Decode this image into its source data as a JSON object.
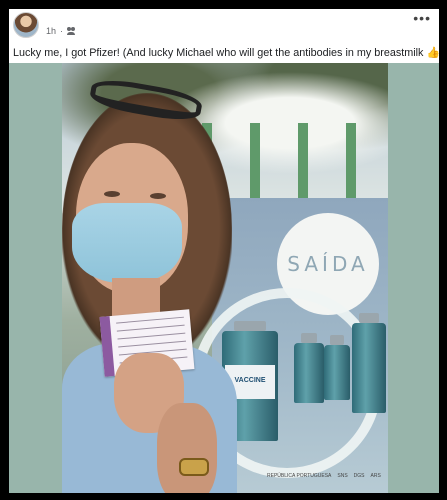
{
  "post": {
    "time": "1h",
    "audience_icon": "friends-icon",
    "more_icon": "more-options-icon",
    "more_label": "•••",
    "text": "Lucky me, I got Pfizer! (And lucky Michael who will get the antibodies in my breastmilk 👍) 💉🎉"
  },
  "photo": {
    "banner_text": "SAÍDA",
    "vaccine_label": "VACCINE",
    "footer_logos": [
      "REPÚBLICA PORTUGUESA",
      "SNS",
      "DGS",
      "ARS"
    ]
  },
  "colors": {
    "page_background": "#000000",
    "card_background": "#ffffff",
    "photo_letterbox": "#98b5ab",
    "accent_purple": "#8c5aa0"
  }
}
